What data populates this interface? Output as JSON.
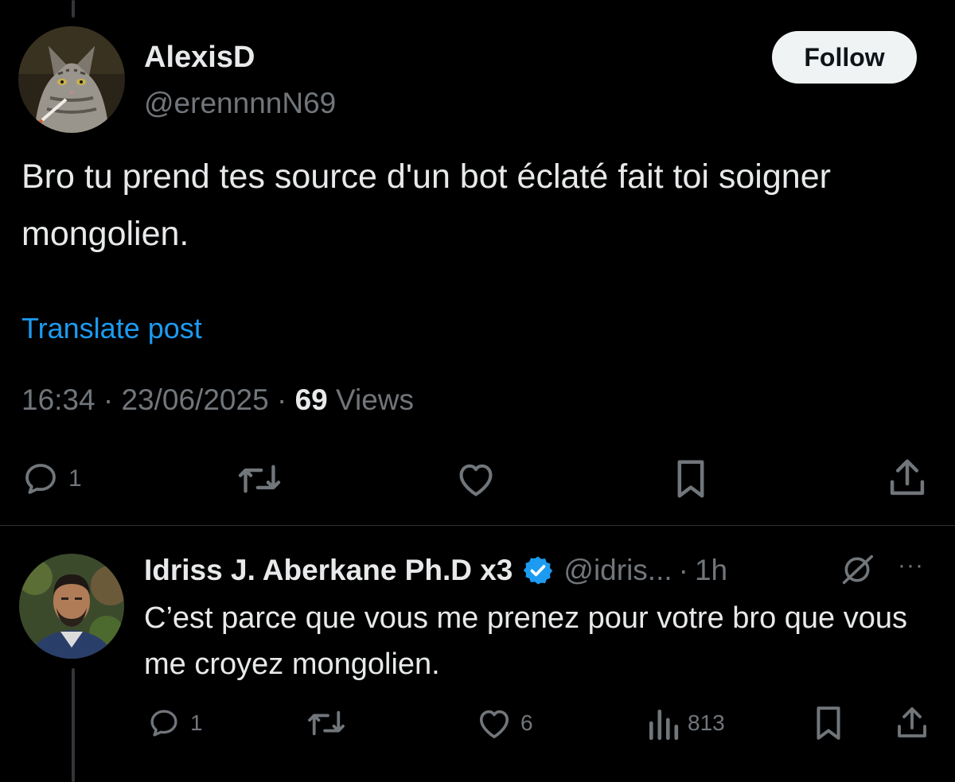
{
  "main_post": {
    "author_name": "AlexisD",
    "author_handle": "@erennnnN69",
    "follow_label": "Follow",
    "text": "Bro tu prend tes source d'un bot éclaté fait toi soigner mongolien.",
    "translate_label": "Translate post",
    "time": "16:34",
    "date": "23/06/2025",
    "views_count": "69",
    "views_label": "Views",
    "separator": "·",
    "actions": {
      "reply_count": "1"
    }
  },
  "reply_post": {
    "author_name": "Idriss J. Aberkane Ph.D x3",
    "author_handle": "@idris...",
    "separator": "·",
    "time_ago": "1h",
    "more_label": "···",
    "text": "C’est parce que vous me prenez pour votre bro que vous me croyez mongolien.",
    "actions": {
      "reply_count": "1",
      "like_count": "6",
      "views_count": "813"
    }
  },
  "colors": {
    "background": "#000000",
    "text_primary": "#e7e9ea",
    "text_secondary": "#71767b",
    "link": "#1d9bf0",
    "verified": "#1d9bf0",
    "follow_button_bg": "#eff3f4"
  },
  "icons": [
    "reply-icon",
    "retweet-icon",
    "like-icon",
    "bookmark-icon",
    "share-icon",
    "views-icon",
    "verified-badge-icon",
    "grok-icon",
    "more-icon"
  ]
}
